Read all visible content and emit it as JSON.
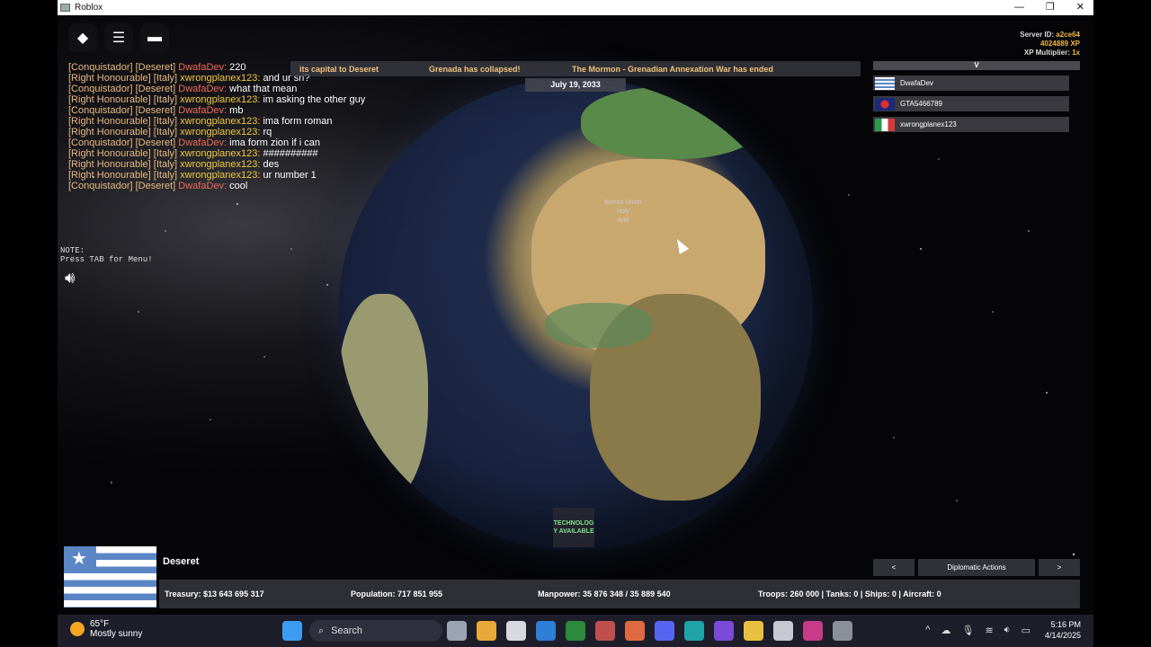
{
  "window": {
    "title": "Roblox",
    "controls": [
      "—",
      "❐",
      "✕"
    ]
  },
  "top_icons": [
    "roblox-logo-icon",
    "menu-icon",
    "chat-icon"
  ],
  "chat": [
    {
      "rank": "[Conquistador]",
      "nation": "[Deseret]",
      "name": "DwafaDev:",
      "name_color": "red",
      "msg": " 220"
    },
    {
      "rank": "[Right Honourable]",
      "nation": "[Italy]",
      "name": "xwrongplanex123:",
      "name_color": "yellow",
      "msg": " and ur sri?"
    },
    {
      "rank": "[Conquistador]",
      "nation": "[Deseret]",
      "name": "DwafaDev:",
      "name_color": "red",
      "msg": " what that mean"
    },
    {
      "rank": "[Right Honourable]",
      "nation": "[Italy]",
      "name": "xwrongplanex123:",
      "name_color": "yellow",
      "msg": " im asking the other guy"
    },
    {
      "rank": "[Conquistador]",
      "nation": "[Deseret]",
      "name": "DwafaDev:",
      "name_color": "red",
      "msg": " mb"
    },
    {
      "rank": "[Right Honourable]",
      "nation": "[Italy]",
      "name": "xwrongplanex123:",
      "name_color": "yellow",
      "msg": " ima form roman"
    },
    {
      "rank": "[Right Honourable]",
      "nation": "[Italy]",
      "name": "xwrongplanex123:",
      "name_color": "yellow",
      "msg": " rq"
    },
    {
      "rank": "[Conquistador]",
      "nation": "[Deseret]",
      "name": "DwafaDev:",
      "name_color": "red",
      "msg": " ima form zion if i can"
    },
    {
      "rank": "[Right Honourable]",
      "nation": "[Italy]",
      "name": "xwrongplanex123:",
      "name_color": "yellow",
      "msg": " ##########"
    },
    {
      "rank": "[Right Honourable]",
      "nation": "[Italy]",
      "name": "xwrongplanex123:",
      "name_color": "yellow",
      "msg": " des"
    },
    {
      "rank": "[Right Honourable]",
      "nation": "[Italy]",
      "name": "xwrongplanex123:",
      "name_color": "yellow",
      "msg": " ur number 1"
    },
    {
      "rank": "[Conquistador]",
      "nation": "[Deseret]",
      "name": "DwafaDev:",
      "name_color": "red",
      "msg": " cool"
    }
  ],
  "note": {
    "line1": "NOTE:",
    "line2": "Press TAB for Menu!"
  },
  "server": {
    "id_label": "Server ID:",
    "id_value": "a2ce64",
    "xp": "4024889 XP",
    "multiplier_label": "XP Multiplier:",
    "multiplier_value": "1x"
  },
  "ticker": [
    "its capital to Deseret",
    "Grenada has collapsed!",
    "The Mormon - Grenadian Annexation War has ended"
  ],
  "date": "July 19, 2033",
  "globe_labels": [
    "Iberian Union",
    "Holy",
    "Arid"
  ],
  "player_list": {
    "header": "V",
    "players": [
      {
        "name": "DwafaDev",
        "flag": "deseret-flag-icon"
      },
      {
        "name": "GTA5466789",
        "flag": "round-emblem-flag-icon"
      },
      {
        "name": "xwrongplanex123",
        "flag": "italy-flag-icon"
      }
    ]
  },
  "tech_notice": "TECHNOLOG Y AVAILABLE",
  "country": {
    "name": "Deseret"
  },
  "stats": {
    "treasury": "Treasury:  $13 643 695 317",
    "population": "Population: 717 851 955",
    "manpower": "Manpower:  35 876 348  /  35 889 540",
    "military": "Troops: 260 000  |  Tanks: 0  |  Ships: 0  |  Aircraft: 0"
  },
  "diplomacy": {
    "prev": "<",
    "label": "Diplomatic Actions",
    "next": ">"
  },
  "taskbar": {
    "weather_temp": "65°F",
    "weather_desc": "Mostly sunny",
    "search_label": "Search",
    "time": "5:16 PM",
    "date": "4/14/2025",
    "apps": [
      "windows-start-icon",
      "file-viewer-icon",
      "chrome-icon",
      "roblox-icon",
      "roblox-studio-icon",
      "minecraft-icon",
      "image-app-icon",
      "vector-app-icon",
      "discord-icon",
      "edge-icon",
      "media-app-icon",
      "file-explorer-icon",
      "snipping-tool-icon",
      "media-player-icon",
      "settings-icon"
    ],
    "app_colors": [
      "#3b9cf0",
      "#9aa4b2",
      "#e8a93a",
      "#d8d8e0",
      "#2d7fd8",
      "#2c8a3b",
      "#c05050",
      "#e06a40",
      "#5865f2",
      "#1fa3a8",
      "#7a4ad8",
      "#e8c040",
      "#c8c8d0",
      "#c83a8a",
      "#8a8f9a"
    ]
  }
}
